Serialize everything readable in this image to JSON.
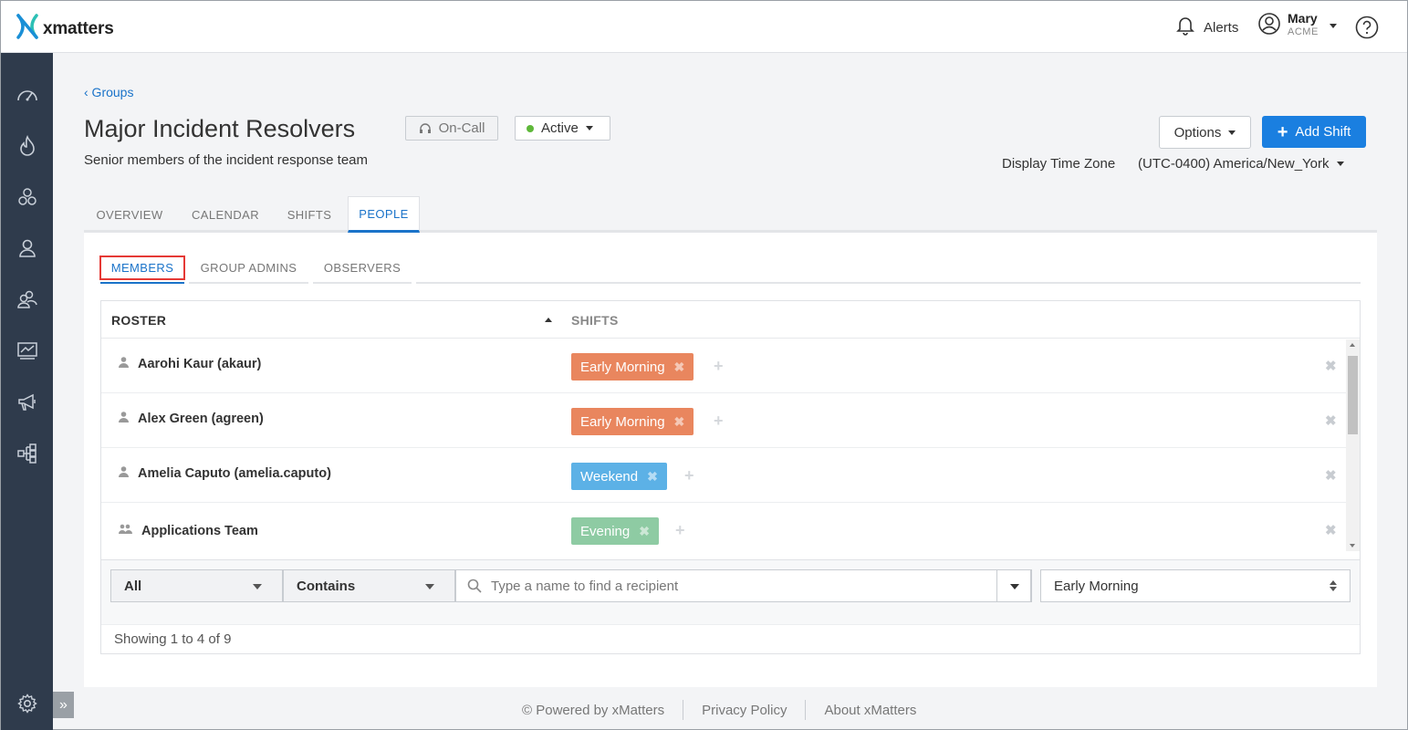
{
  "app": {
    "brand": "xmatters"
  },
  "header": {
    "alerts_label": "Alerts",
    "user_name": "Mary",
    "user_org": "ACME"
  },
  "breadcrumb": "‹ Groups",
  "group": {
    "title": "Major Incident Resolvers",
    "oncall_label": "On-Call",
    "status_label": "Active",
    "description": "Senior members of the incident response team"
  },
  "actions": {
    "options_label": "Options",
    "add_shift_label": "Add Shift"
  },
  "timezone": {
    "label": "Display Time Zone",
    "value": "(UTC-0400) America/New_York"
  },
  "tabs": [
    "OVERVIEW",
    "CALENDAR",
    "SHIFTS",
    "PEOPLE"
  ],
  "active_tab": "PEOPLE",
  "subtabs": [
    "MEMBERS",
    "GROUP ADMINS",
    "OBSERVERS"
  ],
  "active_subtab": "MEMBERS",
  "table": {
    "col_roster": "ROSTER",
    "col_shifts": "SHIFTS",
    "rows": [
      {
        "name": "Aarohi Kaur (akaur)",
        "type": "person",
        "shift": "Early Morning",
        "shift_color": "#e9865e"
      },
      {
        "name": "Alex Green (agreen)",
        "type": "person",
        "shift": "Early Morning",
        "shift_color": "#e9865e"
      },
      {
        "name": "Amelia Caputo (amelia.caputo)",
        "type": "person",
        "shift": "Weekend",
        "shift_color": "#5cb1e6"
      },
      {
        "name": "Applications Team",
        "type": "group",
        "shift": "Evening",
        "shift_color": "#8ecba3"
      }
    ]
  },
  "filters": {
    "type_value": "All",
    "match_value": "Contains",
    "search_placeholder": "Type a name to find a recipient",
    "shift_value": "Early Morning"
  },
  "showing": "Showing 1 to 4 of 9",
  "footer": {
    "powered": "© Powered by xMatters",
    "privacy": "Privacy Policy",
    "about": "About xMatters"
  },
  "colors": {
    "accent": "#1a73c9",
    "primary_button": "#1a7fe0",
    "sidebar": "#2f3b4c"
  }
}
